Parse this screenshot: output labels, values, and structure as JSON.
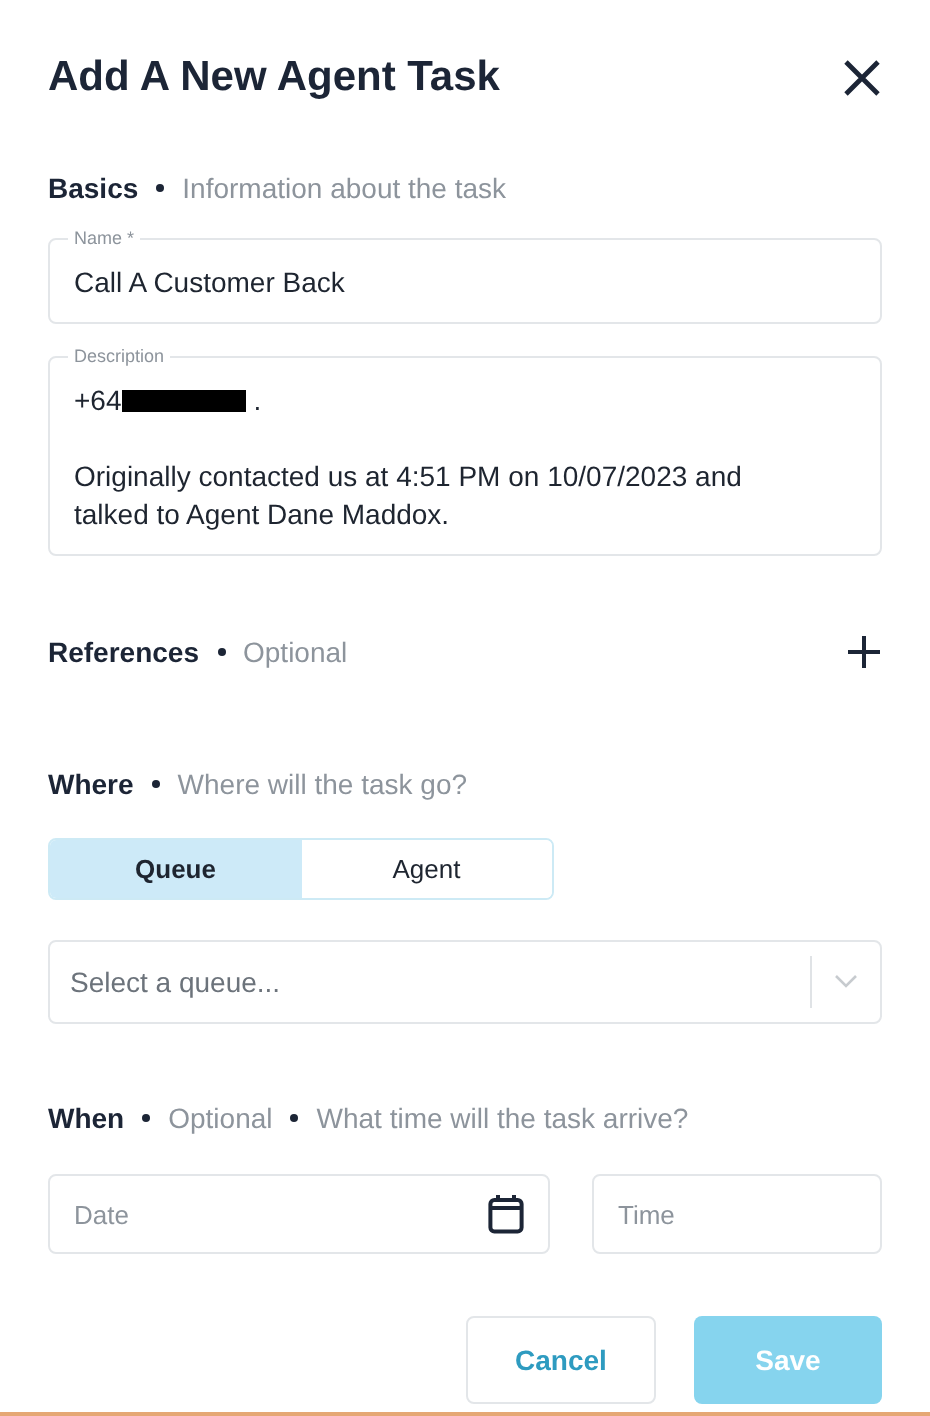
{
  "dialog": {
    "title": "Add A New Agent Task"
  },
  "basics": {
    "title": "Basics",
    "notes": [
      "Information about the task"
    ]
  },
  "name_field": {
    "label": "Name *",
    "value": "Call A Customer Back"
  },
  "description_field": {
    "label": "Description",
    "phone_prefix": "+64",
    "redacted": true,
    "phone_suffix": ".",
    "text": "Originally contacted us at 4:51 PM on 10/07/2023 and talked to Agent Dane Maddox."
  },
  "references": {
    "title": "References",
    "notes": [
      "Optional"
    ]
  },
  "where": {
    "title": "Where",
    "notes": [
      "Where will the task go?"
    ]
  },
  "destination_tabs": [
    {
      "label": "Queue",
      "selected": true
    },
    {
      "label": "Agent",
      "selected": false
    }
  ],
  "queue_select": {
    "placeholder": "Select a queue..."
  },
  "when": {
    "title": "When",
    "notes": [
      "Optional",
      "What time will the task arrive?"
    ]
  },
  "date_field": {
    "placeholder": "Date"
  },
  "time_field": {
    "placeholder": "Time"
  },
  "buttons": [
    {
      "label": "Cancel",
      "kind": "secondary",
      "disabled": false
    },
    {
      "label": "Save",
      "kind": "primary",
      "disabled": true
    }
  ]
}
